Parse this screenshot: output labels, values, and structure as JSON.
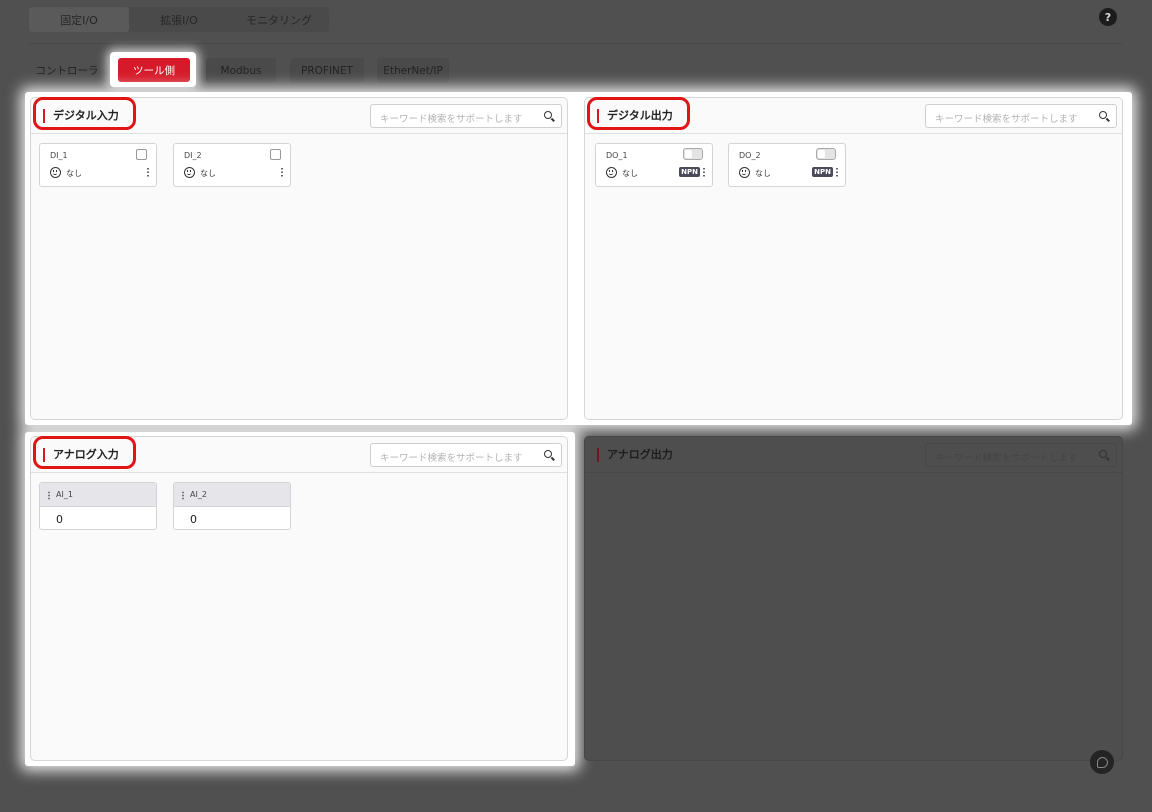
{
  "top_tabs": [
    {
      "label": "固定I/O",
      "active": true
    },
    {
      "label": "拡張I/O",
      "active": false
    },
    {
      "label": "モニタリング",
      "active": false
    }
  ],
  "help_label": "?",
  "sub_tabs": [
    {
      "label": "コントローラ",
      "active": false
    },
    {
      "label": "ツール側",
      "active": true
    },
    {
      "label": "Modbus",
      "active": false
    },
    {
      "label": "PROFINET",
      "active": false
    },
    {
      "label": "EtherNet/IP",
      "active": false
    }
  ],
  "search_placeholder": "キーワード検索をサポートします",
  "panels": {
    "digital_input": {
      "title": "デジタル入力",
      "items": [
        {
          "name": "DI_1",
          "label": "なし"
        },
        {
          "name": "DI_2",
          "label": "なし"
        }
      ]
    },
    "digital_output": {
      "title": "デジタル出力",
      "items": [
        {
          "name": "DO_1",
          "label": "なし",
          "badge": "NPN"
        },
        {
          "name": "DO_2",
          "label": "なし",
          "badge": "NPN"
        }
      ]
    },
    "analog_input": {
      "title": "アナログ入力",
      "items": [
        {
          "name": "AI_1",
          "value": "0"
        },
        {
          "name": "AI_2",
          "value": "0"
        }
      ]
    },
    "analog_output": {
      "title": "アナログ出力"
    }
  },
  "colors": {
    "accent": "#d71a2a",
    "highlight_ring": "#e01515",
    "overlay": "#505050"
  }
}
